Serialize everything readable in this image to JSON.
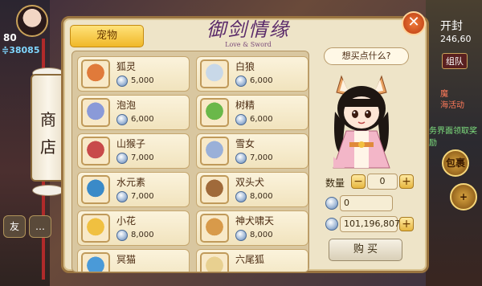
{
  "hud_left": {
    "level": "80",
    "power": "≑38085",
    "shop_label_line1": "商",
    "shop_label_line2": "店",
    "btn_friend": "友",
    "btn_chat": "…"
  },
  "hud_right": {
    "time_label": "开封",
    "coords": "246,60",
    "squad": "组队",
    "task_line": "活动",
    "task_hint": "魔",
    "event_text": "海活动",
    "reward_link": "务界面领取奖励",
    "bag_label": "包裹",
    "plus": "+"
  },
  "panel": {
    "tab_pet": "宠物",
    "logo_main": "御剑情缘",
    "logo_sub": "Love & Sword",
    "speech": "想买点什么?",
    "qty_label": "数量",
    "qty_value": "0",
    "cost_value": "0",
    "balance": "101,196,807",
    "minus": "−",
    "plus": "+",
    "buy_button": "购  买",
    "close": "✕"
  },
  "items": [
    {
      "name": "狐灵",
      "price": "5,000",
      "color": "#e07a3a"
    },
    {
      "name": "白狼",
      "price": "6,000",
      "color": "#c8d8e8"
    },
    {
      "name": "泡泡",
      "price": "6,000",
      "color": "#8a9ad8"
    },
    {
      "name": "树精",
      "price": "6,000",
      "color": "#6ab84a"
    },
    {
      "name": "山猴子",
      "price": "7,000",
      "color": "#c84a4a"
    },
    {
      "name": "雪女",
      "price": "7,000",
      "color": "#9ab0d8"
    },
    {
      "name": "水元素",
      "price": "7,000",
      "color": "#3a8ac8"
    },
    {
      "name": "双头犬",
      "price": "8,000",
      "color": "#a06a3a"
    },
    {
      "name": "小花",
      "price": "8,000",
      "color": "#f0c040"
    },
    {
      "name": "神犬啸天",
      "price": "8,000",
      "color": "#d89a4a"
    },
    {
      "name": "冥猫",
      "price": "",
      "color": "#4a9ad8"
    },
    {
      "name": "六尾狐",
      "price": "",
      "color": "#e8d090"
    }
  ]
}
